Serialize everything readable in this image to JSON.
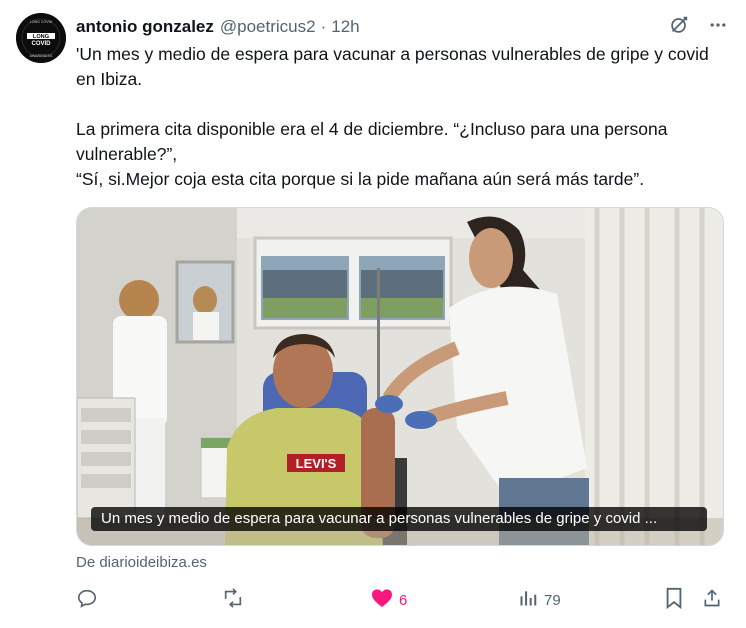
{
  "author": {
    "name": "antonio gonzalez",
    "handle": "@poetricus2",
    "separator": "·",
    "time": "12h",
    "avatar_text": "LONG COVID",
    "avatar_ring_text_top": "LONG COVID",
    "avatar_ring_text_bottom": "AWARENESS"
  },
  "tweet": {
    "line1": "'Un mes y medio de espera para vacunar a personas vulnerables de gripe y covid en Ibiza.",
    "line2": "La primera cita disponible era el 4 de diciembre. “¿Incluso para una persona vulnerable?”,",
    "line3": "“Sí, si.Mejor coja esta cita porque si la pide mañana aún será más tarde”."
  },
  "media": {
    "caption": "Un mes y medio de espera para vacunar a personas vulnerables de gripe y covid ...",
    "shirt_brand": "LEVI'S",
    "link_source": "De diarioideibiza.es"
  },
  "actions": {
    "reply_count": "",
    "repost_count": "",
    "like_count": "6",
    "views_count": "79",
    "like_color": "#f91880"
  },
  "icons": {
    "grok": "grok-icon",
    "more": "more-icon",
    "reply": "reply-icon",
    "repost": "repost-icon",
    "like": "heart-icon",
    "views": "views-icon",
    "bookmark": "bookmark-icon",
    "share": "share-icon"
  }
}
